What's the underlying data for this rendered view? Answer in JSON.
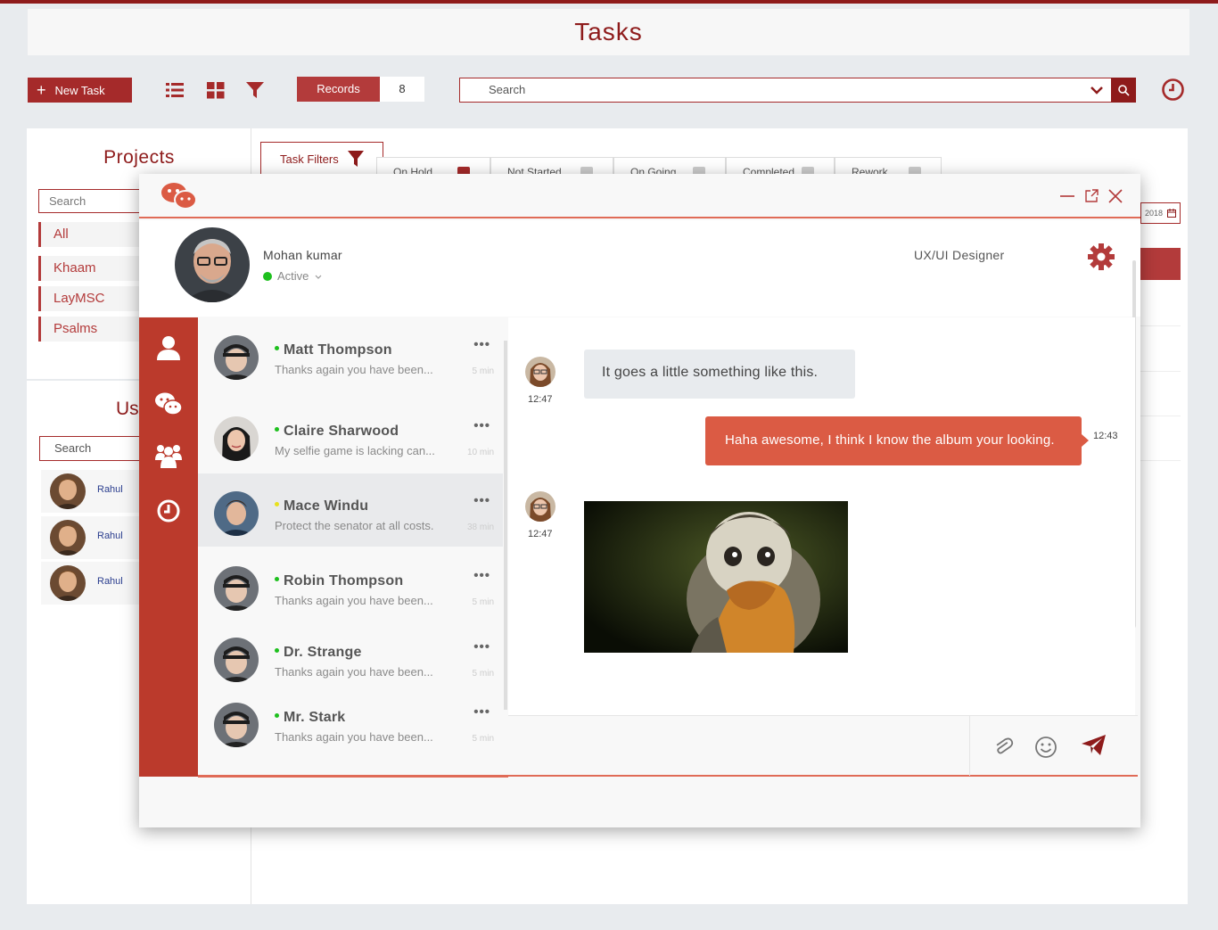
{
  "page_title": "Tasks",
  "toolbar": {
    "new_task_label": "New Task",
    "records_label": "Records",
    "records_count": "8",
    "search_placeholder": "Search"
  },
  "projects": {
    "title": "Projects",
    "search_placeholder": "Search",
    "items": [
      "All",
      "Khaam",
      "LayMSC",
      "Psalms"
    ]
  },
  "users": {
    "title": "Us",
    "search_placeholder": "Search",
    "items": [
      "Rahul",
      "Rahul",
      "Rahul"
    ]
  },
  "task_filters": {
    "label": "Task Filters",
    "tabs": [
      {
        "label": "On Hold",
        "checked": true
      },
      {
        "label": "Not Started",
        "checked": false
      },
      {
        "label": "On Going",
        "checked": false
      },
      {
        "label": "Completed",
        "checked": false
      },
      {
        "label": "Rework",
        "checked": false
      }
    ],
    "date_fragment": "2018"
  },
  "chat": {
    "profile": {
      "name": "Mohan kumar",
      "status": "Active",
      "role": "UX/UI Designer"
    },
    "conversations": [
      {
        "name": "Matt Thompson",
        "preview": "Thanks again you have been...",
        "time": "5 min",
        "status": "online"
      },
      {
        "name": "Claire Sharwood",
        "preview": "My selfie game is lacking can...",
        "time": "10 min",
        "status": "online"
      },
      {
        "name": "Mace Windu",
        "preview": "Protect the senator at all costs.",
        "time": "38 min",
        "status": "away"
      },
      {
        "name": "Robin Thompson",
        "preview": "Thanks again you have been...",
        "time": "5 min",
        "status": "online"
      },
      {
        "name": "Dr. Strange",
        "preview": "Thanks again you have been...",
        "time": "5 min",
        "status": "online"
      },
      {
        "name": "Mr. Stark",
        "preview": "Thanks again you have been...",
        "time": "5 min",
        "status": "online"
      }
    ],
    "messages": [
      {
        "direction": "incoming",
        "text": "It goes a little something like this.",
        "time": "12:47"
      },
      {
        "direction": "outgoing",
        "text": "Haha awesome,  I think I know the album your looking.",
        "time": "12:43"
      },
      {
        "direction": "incoming",
        "type": "image",
        "image": "monkey-photo",
        "time": "12:47"
      }
    ]
  },
  "colors": {
    "brand": "#8e1b1b",
    "accent": "#db5b44",
    "sidebar": "#bb3a2c",
    "online": "#1ec01e",
    "away": "#e8e11c"
  }
}
